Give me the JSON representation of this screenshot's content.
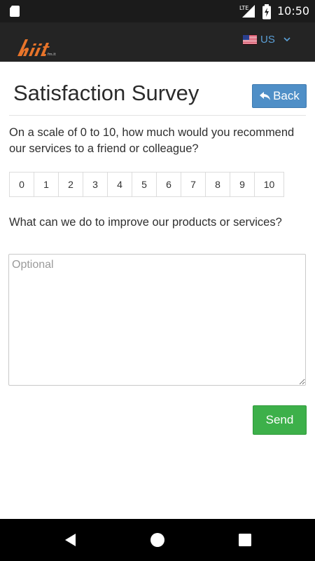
{
  "status_bar": {
    "network": "LTE",
    "time": "10:50"
  },
  "header": {
    "logo_text": "hiit",
    "locale": {
      "label": "US",
      "flag": "us-flag-icon"
    }
  },
  "page": {
    "title": "Satisfaction Survey",
    "back_label": "Back"
  },
  "survey": {
    "question_recommend": "On a scale of 0 to 10, how much would you recommend our services to a friend or colleague?",
    "scale": [
      "0",
      "1",
      "2",
      "3",
      "4",
      "5",
      "6",
      "7",
      "8",
      "9",
      "10"
    ],
    "question_improve": "What can we do to improve our products or services?",
    "comments_placeholder": "Optional",
    "send_label": "Send"
  },
  "colors": {
    "primary": "#4f8fc7",
    "success": "#3db04a",
    "header_bg": "#242424",
    "logo": "#e8742a"
  }
}
